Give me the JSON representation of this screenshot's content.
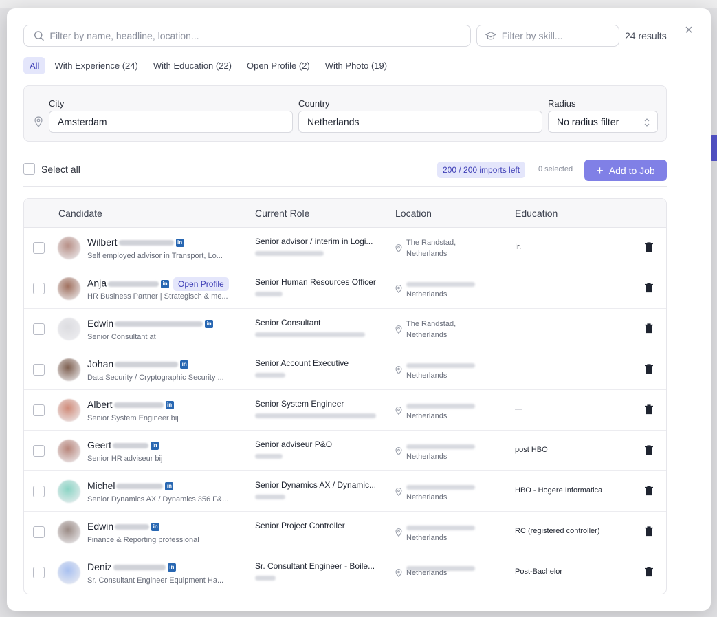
{
  "search": {
    "placeholder": "Filter by name, headline, location..."
  },
  "skill": {
    "placeholder": "Filter by skill..."
  },
  "results_label": "24 results",
  "tabs": [
    {
      "label": "All",
      "active": true
    },
    {
      "label": "With Experience (24)"
    },
    {
      "label": "With Education (22)"
    },
    {
      "label": "Open Profile (2)"
    },
    {
      "label": "With Photo (19)"
    }
  ],
  "location_filter": {
    "city_label": "City",
    "city_value": "Amsterdam",
    "country_label": "Country",
    "country_value": "Netherlands",
    "radius_label": "Radius",
    "radius_value": "No radius filter"
  },
  "toolbar": {
    "select_all": "Select all",
    "imports": "200 / 200 imports left",
    "selected": "0 selected",
    "add_to_job": "Add to Job"
  },
  "table": {
    "headers": {
      "candidate": "Candidate",
      "role": "Current Role",
      "location": "Location",
      "education": "Education"
    },
    "rows": [
      {
        "name": "Wilbert",
        "headline": "Self employed advisor in Transport, Lo...",
        "role": "Senior advisor / interim in Logi...",
        "location_line1": "The Randstad,",
        "location_line2": "Netherlands",
        "education": "Ir.",
        "avatar_color": "#b78f86"
      },
      {
        "name": "Anja",
        "open_profile": "Open Profile",
        "headline": "HR Business Partner | Strategisch & me...",
        "role": "Senior Human Resources Officer",
        "location_line1": "",
        "location_line2": "Netherlands",
        "education": "",
        "avatar_color": "#a0705e"
      },
      {
        "name": "Edwin",
        "headline": "Senior Consultant at",
        "role": "Senior Consultant",
        "location_line1": "The Randstad,",
        "location_line2": "Netherlands",
        "education": "",
        "avatar_color": "#dcdce0"
      },
      {
        "name": "Johan",
        "headline": "Data Security / Cryptographic Security ...",
        "role": "Senior Account Executive",
        "location_line1": "",
        "location_line2": "Netherlands",
        "education": "",
        "avatar_color": "#7d5e4e"
      },
      {
        "name": "Albert",
        "headline": "Senior System Engineer bij",
        "role": "Senior System Engineer",
        "location_line1": "",
        "location_line2": "Netherlands",
        "education": "—",
        "avatar_color": "#d08a78"
      },
      {
        "name": "Geert",
        "headline": "Senior HR adviseur bij",
        "role": "Senior adviseur P&O",
        "location_line1": "",
        "location_line2": "Netherlands",
        "education": "post HBO",
        "avatar_color": "#b8857a"
      },
      {
        "name": "Michel",
        "headline": "Senior Dynamics AX / Dynamics 356 F&...",
        "role": "Senior Dynamics AX / Dynamic...",
        "location_line1": "",
        "location_line2": "Netherlands",
        "education": "HBO - Hogere Informatica",
        "avatar_color": "#8ad4c4"
      },
      {
        "name": "Edwin",
        "headline": "Finance & Reporting professional",
        "role": "Senior Project Controller",
        "location_line1": "",
        "location_line2": "Netherlands",
        "education": "RC (registered controller)",
        "avatar_color": "#9a8a84"
      },
      {
        "name": "Deniz",
        "headline": "Sr. Consultant Engineer Equipment Ha...",
        "role": "Sr. Consultant Engineer - Boile...",
        "location_line1": "",
        "location_line2": "Netherlands",
        "education": "Post-Bachelor",
        "avatar_color": "#a8c0f0"
      }
    ]
  },
  "colors": {
    "accent": "#8080e6",
    "accent_soft": "#e4e6fb",
    "linkedin": "#2867b2"
  }
}
